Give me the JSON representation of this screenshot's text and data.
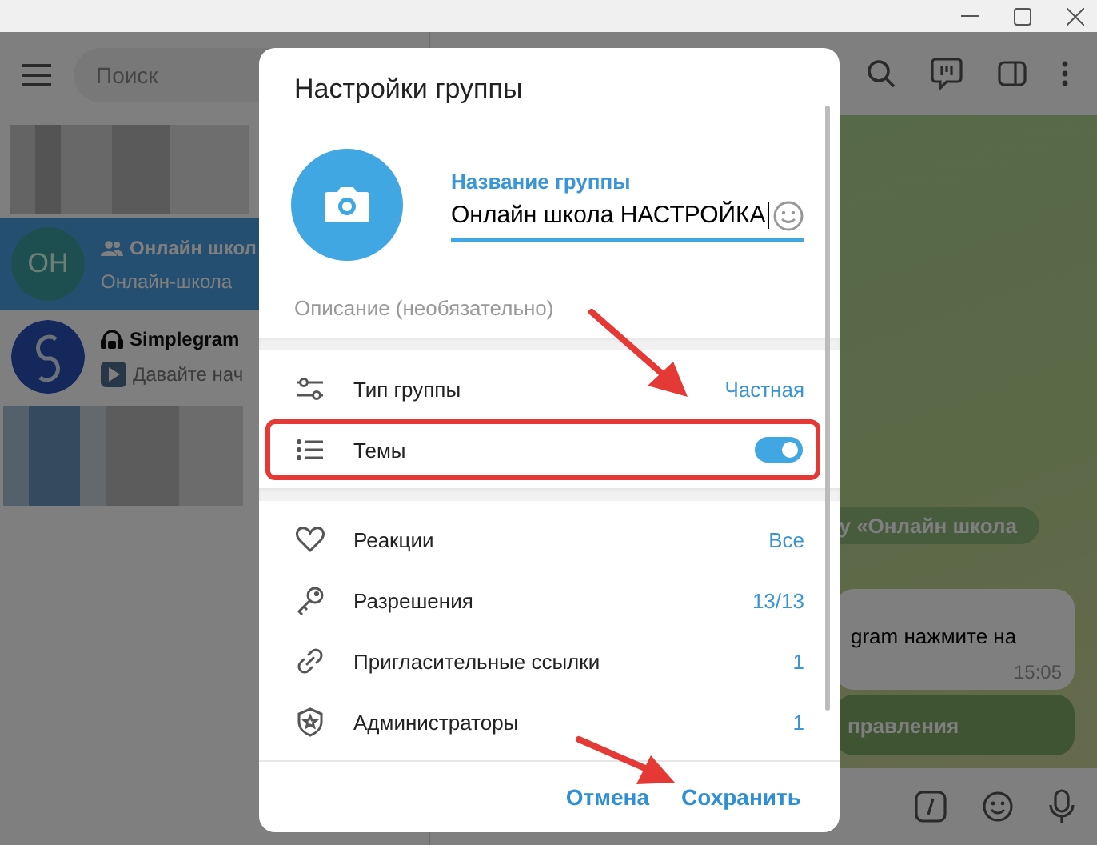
{
  "sidebar": {
    "search": {
      "placeholder": "Поиск"
    },
    "chats": [
      {
        "kind": "group",
        "avatar_text": "ОН",
        "title": "Онлайн школ",
        "preview": "Онлайн-школа",
        "selected": true
      },
      {
        "kind": "bot",
        "title": "Simplegram",
        "preview": "Давайте нач",
        "selected": false
      }
    ]
  },
  "chat": {
    "service_message": "у «Онлайн школа",
    "message": {
      "text": "gram нажмите на",
      "time": "15:05"
    },
    "inline_button": "правления"
  },
  "dialog": {
    "title": "Настройки группы",
    "name_field": {
      "label": "Название группы",
      "value": "Онлайн школа НАСТРОЙКА"
    },
    "description": {
      "placeholder": "Описание (необязательно)"
    },
    "sections": [
      {
        "rows": [
          {
            "kind": "value",
            "label": "Тип группы",
            "value": "Частная",
            "highlighted": false
          },
          {
            "kind": "toggle",
            "label": "Темы",
            "on": true,
            "highlighted": true
          }
        ]
      },
      {
        "rows": [
          {
            "kind": "value",
            "label": "Реакции",
            "value": "Все",
            "highlighted": false
          },
          {
            "kind": "value",
            "label": "Разрешения",
            "value": "13/13",
            "highlighted": false
          },
          {
            "kind": "value",
            "label": "Пригласительные ссылки",
            "value": "1",
            "highlighted": false
          },
          {
            "kind": "value",
            "label": "Администраторы",
            "value": "1",
            "highlighted": false
          }
        ]
      }
    ],
    "buttons": [
      {
        "label": "Отмена"
      },
      {
        "label": "Сохранить"
      }
    ]
  }
}
